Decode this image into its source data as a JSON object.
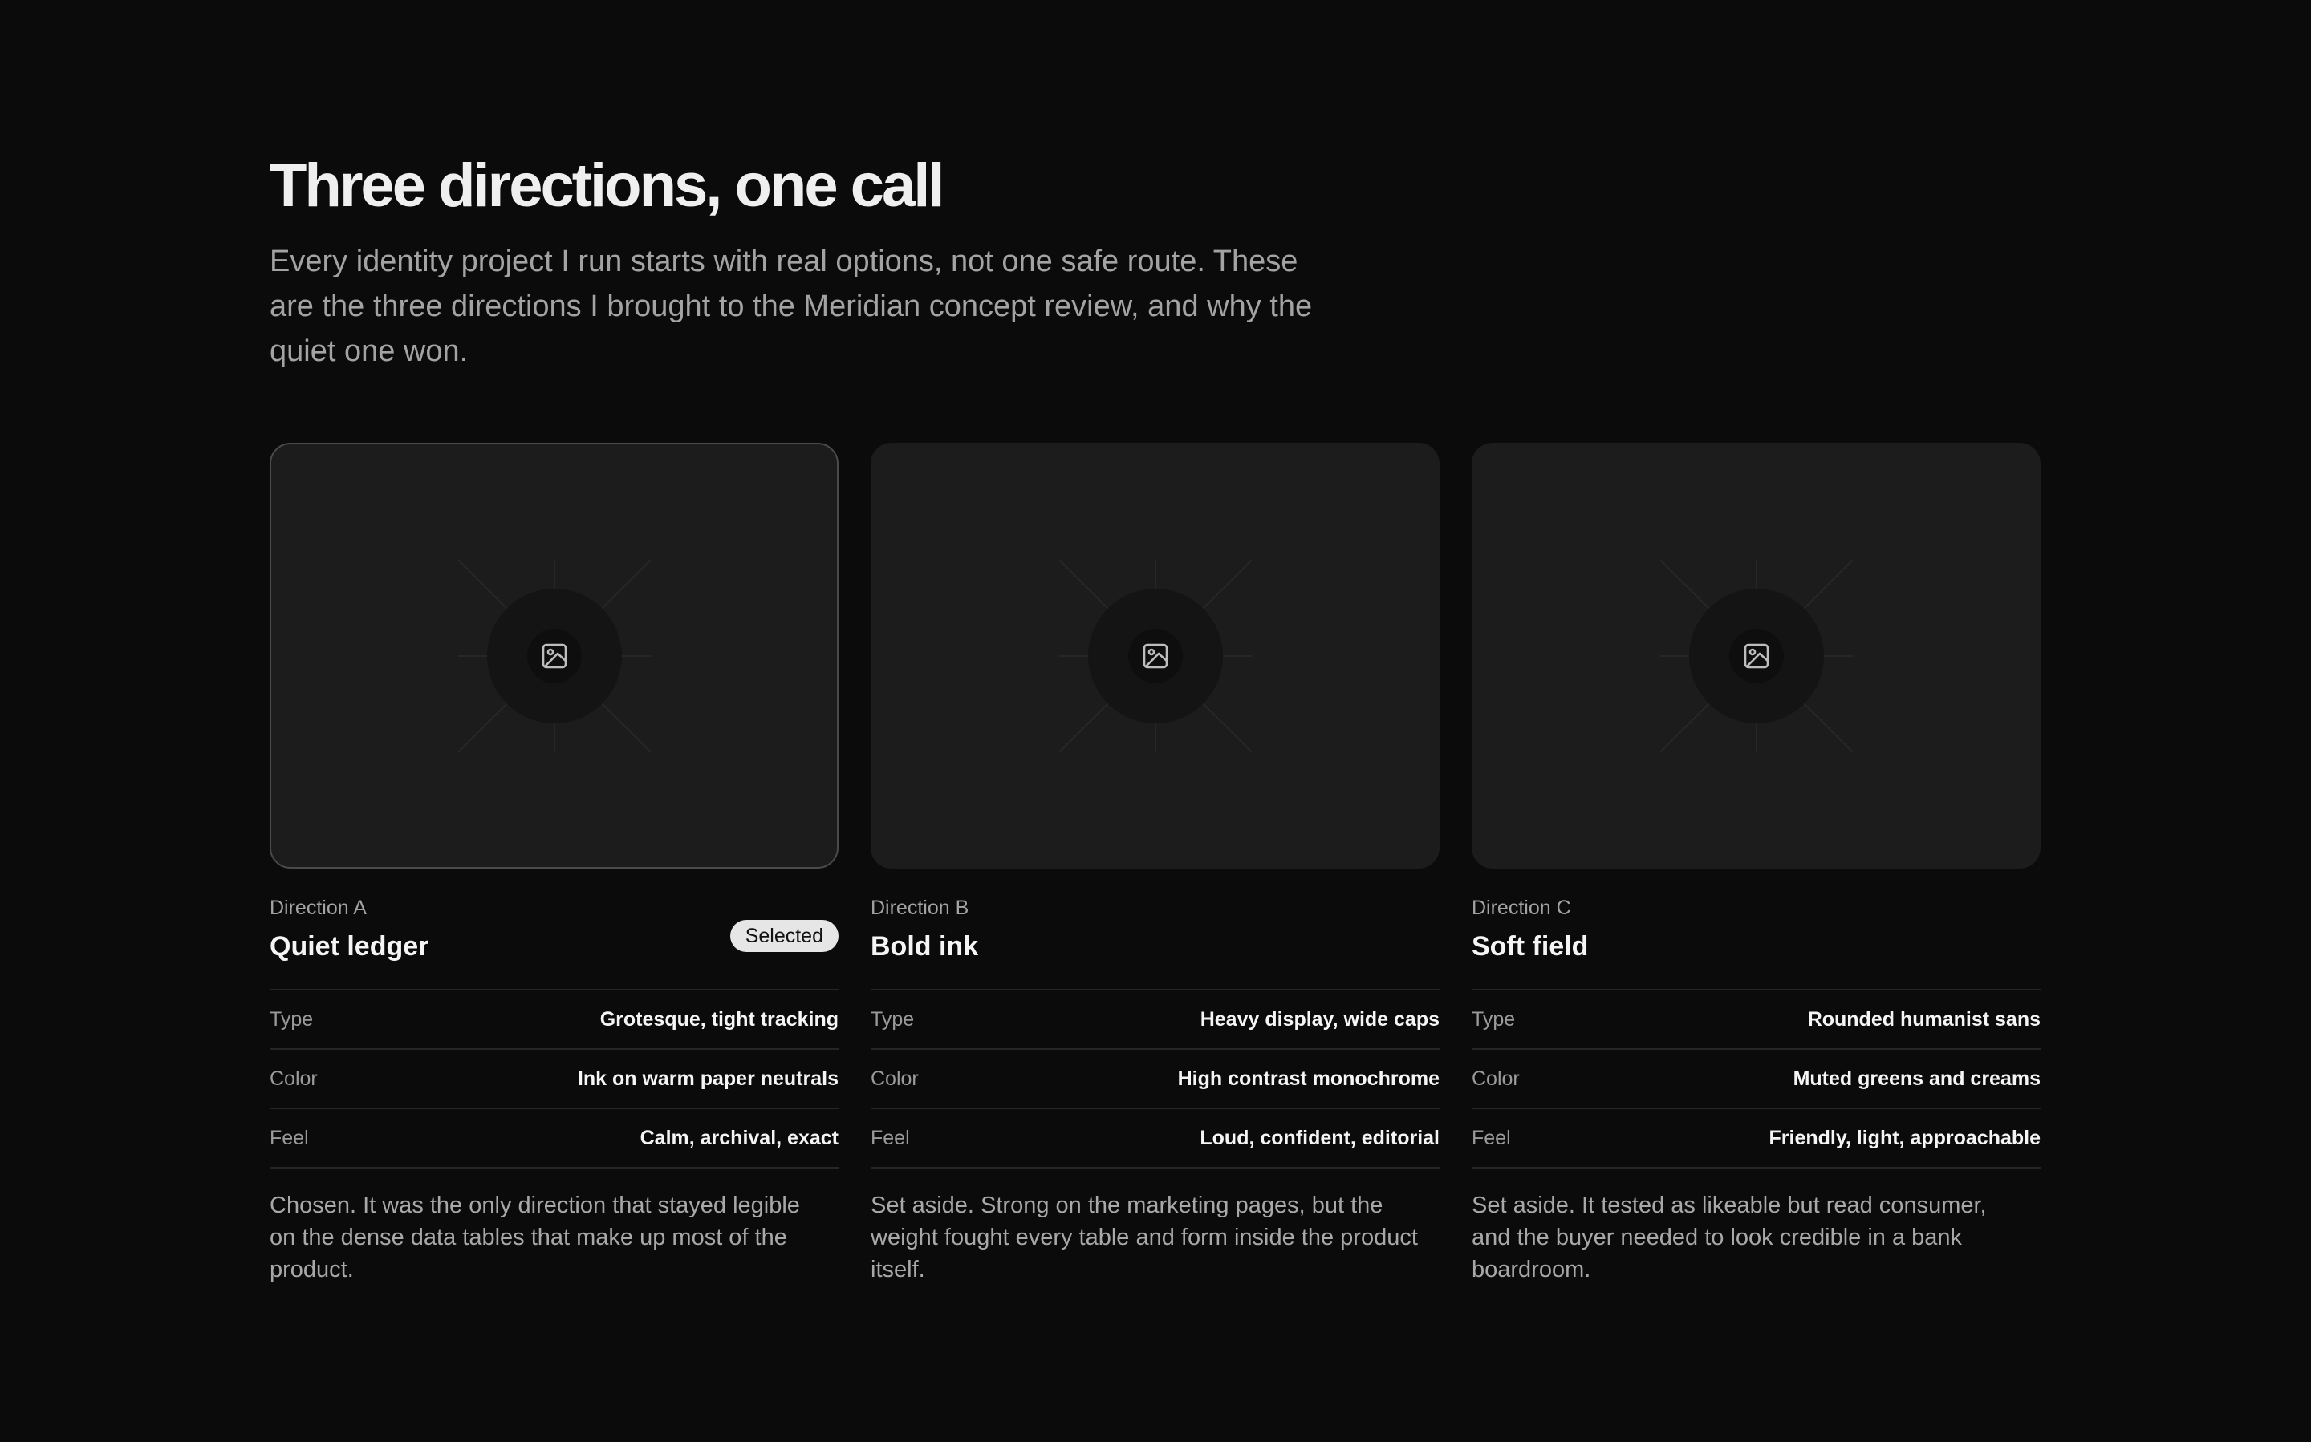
{
  "header": {
    "title": "Three directions, one call",
    "intro": "Every identity project I run starts with real options, not one safe route. These are the three directions I brought to the Meridian concept review, and why the quiet one won."
  },
  "cards": [
    {
      "direction": "Direction A",
      "name": "Quiet ledger",
      "badge": "Selected",
      "image_icon": "image-icon",
      "attributes": [
        {
          "key": "Type",
          "value": "Grotesque, tight tracking"
        },
        {
          "key": "Color",
          "value": "Ink on warm paper neutrals"
        },
        {
          "key": "Feel",
          "value": "Calm, archival, exact"
        }
      ],
      "note": "Chosen. It was the only direction that stayed legible on the dense data tables that make up most of the product."
    },
    {
      "direction": "Direction B",
      "name": "Bold ink",
      "image_icon": "image-icon",
      "attributes": [
        {
          "key": "Type",
          "value": "Heavy display, wide caps"
        },
        {
          "key": "Color",
          "value": "High contrast monochrome"
        },
        {
          "key": "Feel",
          "value": "Loud, confident, editorial"
        }
      ],
      "note": "Set aside. Strong on the marketing pages, but the weight fought every table and form inside the product itself."
    },
    {
      "direction": "Direction C",
      "name": "Soft field",
      "image_icon": "image-icon",
      "attributes": [
        {
          "key": "Type",
          "value": "Rounded humanist sans"
        },
        {
          "key": "Color",
          "value": "Muted greens and creams"
        },
        {
          "key": "Feel",
          "value": "Friendly, light, approachable"
        }
      ],
      "note": "Set aside. It tested as likeable but read consumer, and the buyer needed to look credible in a bank boardroom."
    }
  ],
  "colors": {
    "background": "#0b0b0b",
    "card": "#1c1c1c",
    "badge": "#e6e6e6",
    "muted_text": "#a3a3a3"
  }
}
